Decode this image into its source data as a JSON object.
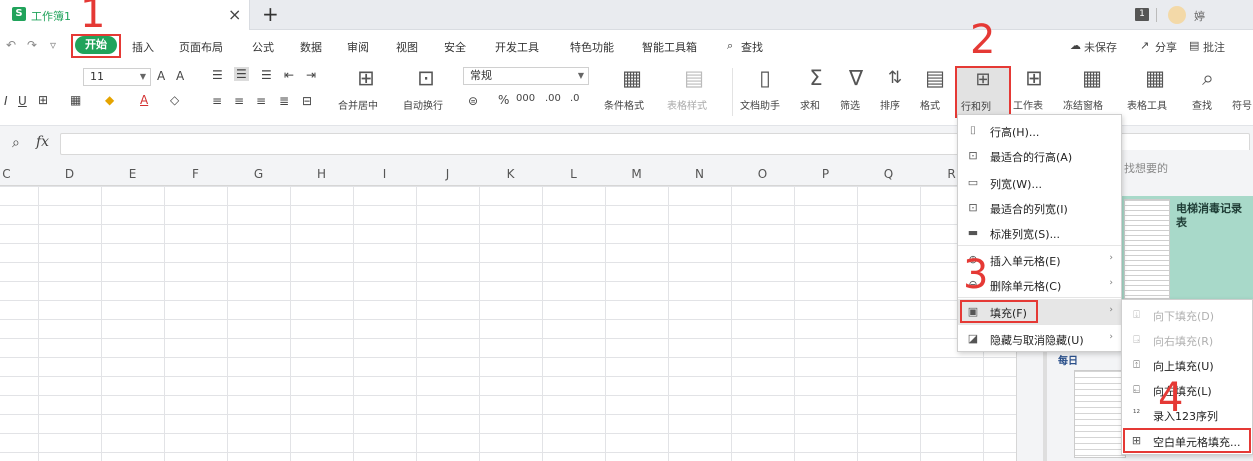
{
  "tabs": {
    "doc_icon_letter": "S",
    "doc_title": "工作簿1",
    "close_glyph": "×",
    "new_tab_glyph": "+",
    "window_badge": "1",
    "user_name": "婷"
  },
  "menubar": {
    "quick_access": [
      "↶",
      "↷",
      "▿"
    ],
    "items": [
      "开始",
      "插入",
      "页面布局",
      "公式",
      "数据",
      "审阅",
      "视图",
      "安全",
      "开发工具",
      "特色功能",
      "智能工具箱",
      "查找"
    ],
    "right": {
      "unsaved": "未保存",
      "share": "分享",
      "comment": "批注"
    }
  },
  "ribbon": {
    "font_size": "11",
    "number_format": "常规",
    "merge_center": "合并居中",
    "auto_wrap": "自动换行",
    "conditional_format": "条件格式",
    "table_style": "表格样式",
    "doc_assistant": "文档助手",
    "sum": "求和",
    "filter": "筛选",
    "sort": "排序",
    "format": "格式",
    "row_col": "行和列",
    "worksheet": "工作表",
    "freeze_panes": "冻结窗格",
    "table_tools": "表格工具",
    "find": "查找",
    "symbol": "符号"
  },
  "formula_bar": {
    "fx_label": "fx",
    "value": ""
  },
  "columns": [
    "C",
    "D",
    "E",
    "F",
    "G",
    "H",
    "I",
    "J",
    "K",
    "L",
    "M",
    "N",
    "O",
    "P",
    "Q",
    "R"
  ],
  "side_panel": {
    "hint": "找想要的",
    "template_title": "电梯消毒记录表",
    "template2_head": "每日"
  },
  "rowcol_menu": {
    "items": [
      {
        "label": "行高(H)...",
        "icon": "row-height-icon"
      },
      {
        "label": "最适合的行高(A)",
        "icon": "auto-row-height-icon"
      },
      {
        "label": "列宽(W)...",
        "icon": "column-width-icon"
      },
      {
        "label": "最适合的列宽(I)",
        "icon": "auto-column-width-icon"
      },
      {
        "label": "标准列宽(S)...",
        "icon": "standard-width-icon"
      },
      {
        "label": "插入单元格(E)",
        "icon": "insert-cell-icon"
      },
      {
        "label": "删除单元格(C)",
        "icon": "delete-cell-icon"
      },
      {
        "label": "填充(F)",
        "icon": "fill-icon"
      },
      {
        "label": "隐藏与取消隐藏(U)",
        "icon": "hide-unhide-icon"
      }
    ]
  },
  "fill_submenu": {
    "items": [
      {
        "label": "向下填充(D)",
        "enabled": false,
        "icon": "fill-down-icon"
      },
      {
        "label": "向右填充(R)",
        "enabled": false,
        "icon": "fill-right-icon"
      },
      {
        "label": "向上填充(U)",
        "enabled": true,
        "icon": "fill-up-icon"
      },
      {
        "label": "向左填充(L)",
        "enabled": true,
        "icon": "fill-left-icon"
      },
      {
        "label": "录入123序列",
        "enabled": true,
        "icon": "series-icon"
      },
      {
        "label": "空白单元格填充...",
        "enabled": true,
        "icon": "blank-fill-icon"
      }
    ]
  },
  "annotations": [
    "1",
    "2",
    "3",
    "4"
  ],
  "colors": {
    "brand_green": "#21a35b",
    "annotation_red": "#e53935"
  }
}
